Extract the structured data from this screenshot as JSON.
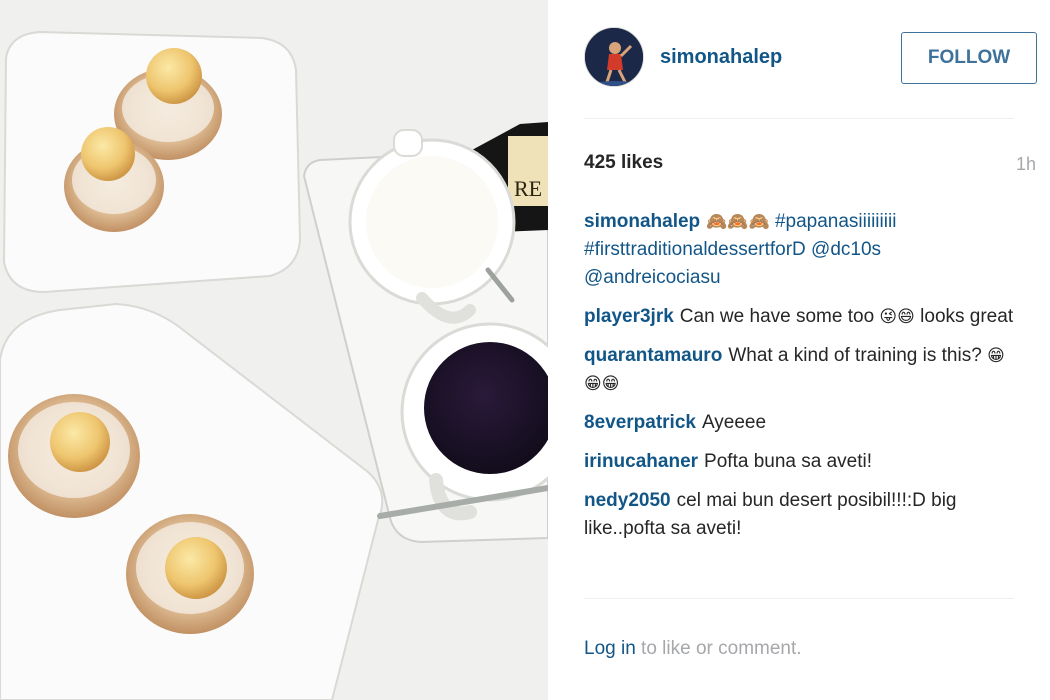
{
  "post": {
    "username": "simonahalep",
    "follow_label": "FOLLOW",
    "likes": "425 likes",
    "time": "1h",
    "caption": {
      "user": "simonahalep",
      "emoji": "🙈🙈🙈",
      "tag1": "#papanasiiiiiiiii",
      "tag2": "#firsttraditionaldessertforD",
      "mention1": "@dc10s",
      "mention2": "@andreicociasu"
    },
    "comments": [
      {
        "user": "player3jrk",
        "text": "Can we have some too",
        "emoji": "😜😄",
        "text2": "looks great"
      },
      {
        "user": "quarantamauro",
        "text": "What a kind of training is this?",
        "emoji": "😁😁😁"
      },
      {
        "user": "8everpatrick",
        "text": "Ayeeee"
      },
      {
        "user": "irinucahaner",
        "text": "Pofta buna sa aveti!"
      },
      {
        "user": "nedy2050",
        "text": "cel mai bun desert posibil!!!:D big like..pofta sa aveti!"
      }
    ],
    "login_link": "Log in",
    "login_rest": " to like or comment."
  },
  "colors": {
    "link": "#125688",
    "follow": "#3f729b",
    "muted": "#a5a7aa"
  }
}
